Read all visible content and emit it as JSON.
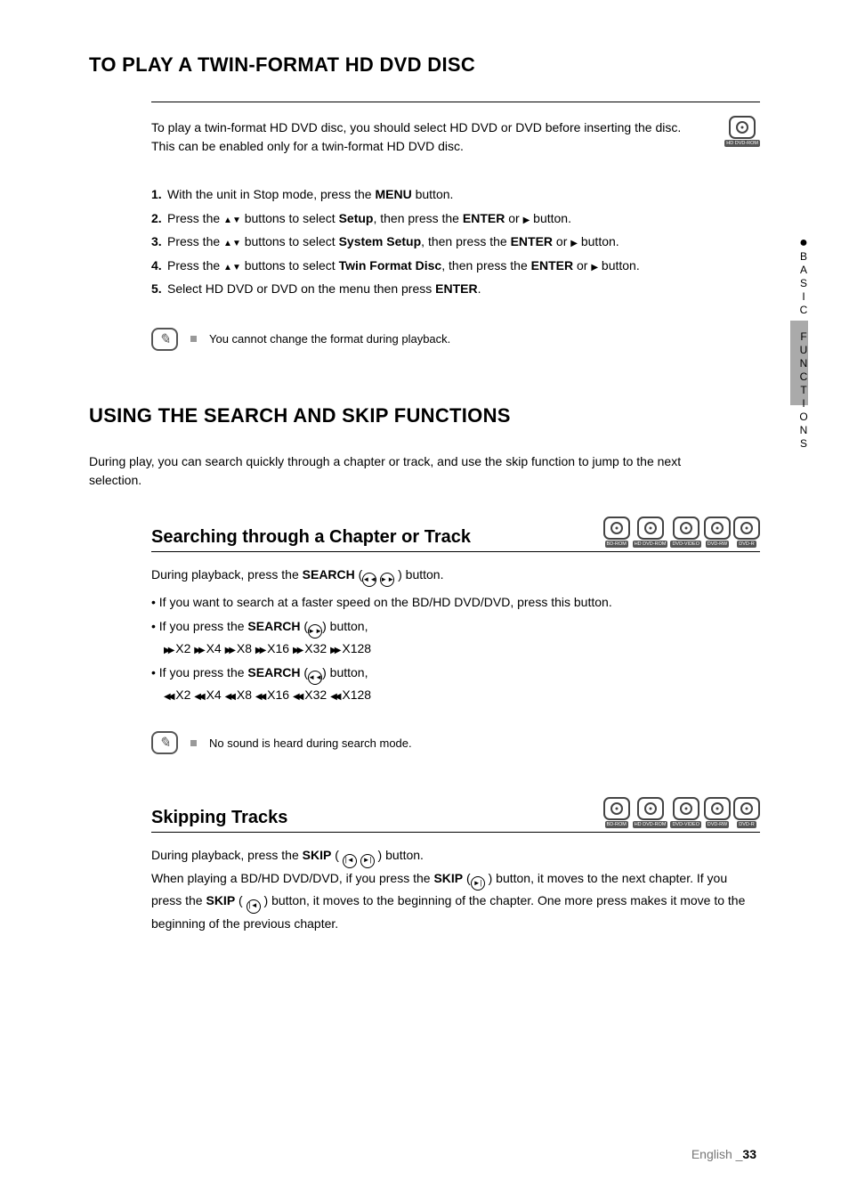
{
  "sideTab": {
    "label": "BASIC FUNCTIONS"
  },
  "section1": {
    "title": "TO PLAY A TWIN-FORMAT HD DVD DISC",
    "intro1": "To play a twin-format HD DVD disc, you should select HD DVD or DVD before inserting the disc.",
    "intro2": "This can be enabled only for a twin-format HD DVD disc.",
    "discLabel": "HD DVD-ROM",
    "steps": [
      {
        "n": "1.",
        "pre": "With the unit in Stop mode, press the ",
        "b1": "MENU",
        "post": " button."
      },
      {
        "n": "2.",
        "pre": "Press the ",
        "arrows": true,
        "mid": " buttons to select ",
        "b1": "Setup",
        "mid2": ", then press the ",
        "b2": "ENTER",
        "or": " or ",
        "tri": true,
        "post": " button."
      },
      {
        "n": "3.",
        "pre": "Press the ",
        "arrows": true,
        "mid": " buttons to select ",
        "b1": "System Setup",
        "mid2": ", then press the ",
        "b2": "ENTER",
        "or": " or ",
        "tri": true,
        "post": " button."
      },
      {
        "n": "4.",
        "pre": "Press the ",
        "arrows": true,
        "mid": " buttons to select ",
        "b1": "Twin Format Disc",
        "mid2": ", then press the ",
        "b2": "ENTER",
        "or": " or ",
        "tri": true,
        "post": " button."
      },
      {
        "n": "5.",
        "pre": "Select HD DVD or DVD on the menu then press ",
        "b1": "ENTER",
        "post": "."
      }
    ],
    "note": "You cannot change the format during playback."
  },
  "section2": {
    "title": "USING THE SEARCH AND SKIP FUNCTIONS",
    "intro": "During play, you can search quickly through a chapter or track, and use the skip function to jump to the next selection.",
    "sub1": {
      "title": "Searching through a Chapter or Track",
      "discs": [
        "BD-ROM",
        "HD DVD-ROM",
        "DVD-VIDEO",
        "DVD-RW",
        "DVD-R"
      ],
      "line1_pre": "During playback, press the ",
      "line1_b": "SEARCH",
      "line1_post": " button.",
      "bullet1": "If you want to search at a faster speed on the BD/HD DVD/DVD, press this button.",
      "bullet2_pre": "If you press the ",
      "bullet2_b": "SEARCH",
      "bullet2_post": " button,",
      "speeds_fwd": " X2  X4  X8  X16  X32  X128",
      "bullet3_pre": "If you press the ",
      "bullet3_b": "SEARCH",
      "bullet3_post": " button,",
      "speeds_rew": " X2  X4  X8  X16  X32  X128",
      "note": "No sound is heard during search mode."
    },
    "sub2": {
      "title": "Skipping Tracks",
      "discs": [
        "BD-ROM",
        "HD DVD-ROM",
        "DVD-VIDEO",
        "DVD-RW",
        "DVD-R"
      ],
      "line1_pre": "During playback, press the ",
      "line1_b": "SKIP",
      "line1_post": " button.",
      "para_a": "When playing a BD/HD DVD/DVD, if you press the ",
      "para_b1": "SKIP",
      "para_b": " button, it moves to the next chapter. If you press the ",
      "para_b2": "SKIP",
      "para_c": " button, it moves to the beginning of the chapter. One more press makes it move to the beginning of the previous chapter."
    }
  },
  "footer": {
    "lang": "English _",
    "page": "33"
  }
}
